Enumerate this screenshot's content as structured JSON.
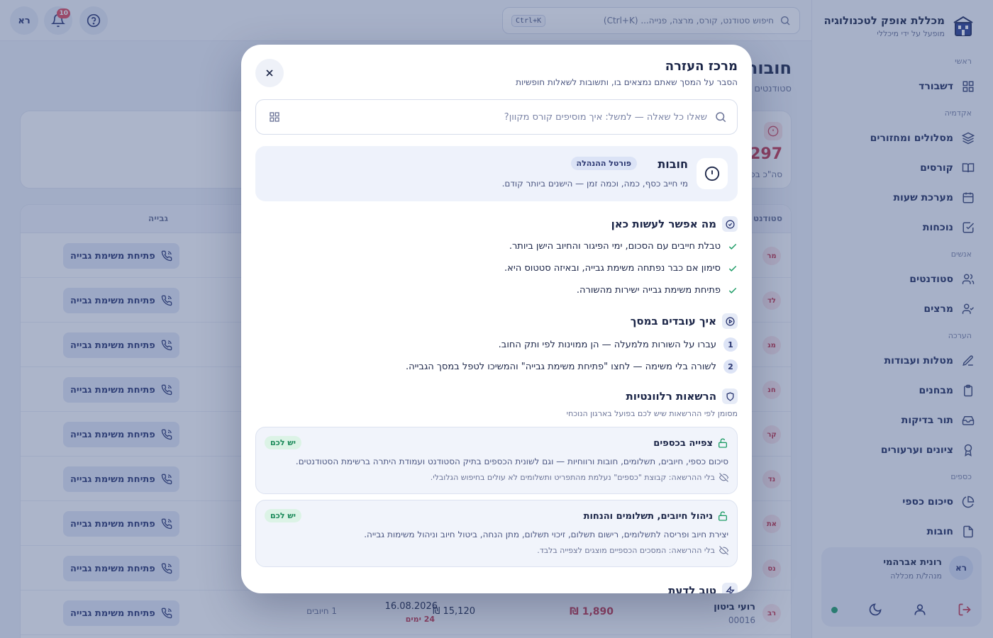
{
  "brand": {
    "title": "מכללת אופק לטכנולוגיה",
    "subtitle": "מופעל על ידי מיכללי"
  },
  "topbar": {
    "search_placeholder": "חיפוש סטודנט, קורס, מרצה, פנייה... (Ctrl+K)",
    "search_shortcut": "Ctrl+K",
    "notifications_count": "10",
    "user_initials": "רא"
  },
  "sidebar": {
    "sections": [
      {
        "label": "ראשי",
        "items": [
          {
            "label": "דשבורד",
            "icon": "dashboard-icon"
          }
        ]
      },
      {
        "label": "אקדמיה",
        "items": [
          {
            "label": "מסלולים ומחזורים",
            "icon": "layers-icon"
          },
          {
            "label": "קורסים",
            "icon": "book-icon"
          },
          {
            "label": "מערכת שעות",
            "icon": "calendar-icon"
          },
          {
            "label": "נוכחות",
            "icon": "check-square-icon"
          }
        ]
      },
      {
        "label": "אנשים",
        "items": [
          {
            "label": "סטודנטים",
            "icon": "users-icon"
          },
          {
            "label": "מרצים",
            "icon": "user-check-icon"
          }
        ]
      },
      {
        "label": "הערכה",
        "items": [
          {
            "label": "מטלות ועבודות",
            "icon": "pen-icon"
          },
          {
            "label": "מבחנים",
            "icon": "clipboard-icon"
          },
          {
            "label": "תור בדיקות",
            "icon": "inbox-icon"
          },
          {
            "label": "ציונים וערעורים",
            "icon": "award-icon"
          }
        ]
      },
      {
        "label": "כספים",
        "items": [
          {
            "label": "סיכום כספי",
            "icon": "pie-chart-icon"
          },
          {
            "label": "חובות",
            "icon": "file-icon"
          }
        ]
      }
    ],
    "user": {
      "initials": "רא",
      "name": "רונית אברהמי",
      "role": "מנהל/ת מכללה"
    }
  },
  "page": {
    "title": "חובות",
    "subtitle": "סטודנטים",
    "stat_value": ",297",
    "stat_label": "סה\"כ בפ",
    "table_headers": {
      "student": "סטודנט",
      "collection": "גבייה"
    },
    "collect_label": "פתיחת משימת גבייה",
    "rows": [
      {
        "initials": "מר",
        "name": "",
        "id": "",
        "debt": "",
        "total": "",
        "date": "",
        "days": "",
        "count": ""
      },
      {
        "initials": "לד",
        "name": "",
        "id": "",
        "debt": "",
        "total": "",
        "date": "",
        "days": "",
        "count": ""
      },
      {
        "initials": "מג",
        "name": "",
        "id": "",
        "debt": "",
        "total": "",
        "date": "",
        "days": "",
        "count": ""
      },
      {
        "initials": "חנ",
        "name": "",
        "id": "",
        "debt": "",
        "total": "",
        "date": "",
        "days": "",
        "count": ""
      },
      {
        "initials": "קר",
        "name": "",
        "id": "",
        "debt": "",
        "total": "",
        "date": "",
        "days": "",
        "count": ""
      },
      {
        "initials": "נד",
        "name": "",
        "id": "",
        "debt": "",
        "total": "",
        "date": "",
        "days": "",
        "count": ""
      },
      {
        "initials": "את",
        "name": "",
        "id": "",
        "debt": "",
        "total": "",
        "date": "",
        "days": "",
        "count": ""
      },
      {
        "initials": "נס",
        "name": "",
        "id": "",
        "debt": "",
        "total": "",
        "date": "",
        "days": "",
        "count": ""
      },
      {
        "initials": "רב",
        "name": "רועי ביטון",
        "id": "00016",
        "debt": "₪ 1,890",
        "total": "₪ 15,120",
        "date": "16.08.2026",
        "days": "24 ימים",
        "count": "1 חיובים"
      }
    ]
  },
  "help": {
    "title": "מרכז העזרה",
    "subtitle": "הסבר על המסך שאתם נמצאים בו, ותשובות לשאלות חופשיות",
    "search_placeholder": "שאלו כל שאלה — למשל: איך מוסיפים קורס מקוון?",
    "page": {
      "title": "חובות",
      "badge": "פורטל ההנהלה",
      "description": "מי חייב כסף, כמה, וכמה זמן — הישנים ביותר קודם."
    },
    "can_do": {
      "title": "מה אפשר לעשות כאן",
      "items": [
        "טבלת חייבים עם הסכום, ימי הפיגור והחיוב הישן ביותר.",
        "סימון אם כבר נפתחה משימת גבייה, ובאיזה סטטוס היא.",
        "פתיחת משימת גבייה ישירות מהשורה."
      ]
    },
    "how_to": {
      "title": "איך עובדים במסך",
      "steps": [
        {
          "num": "1",
          "text": "עברו על השורות מלמעלה — הן ממוינות לפי ותק החוב."
        },
        {
          "num": "2",
          "text": "לשורה בלי משימה — לחצו \"פתיחת משימת גבייה\" והמשיכו לטפל במסך הגבייה."
        }
      ]
    },
    "permissions": {
      "title": "הרשאות רלוונטיות",
      "note": "מסומן לפי ההרשאות שיש לכם בפועל בארגון הנוכחי",
      "cards": [
        {
          "title": "צפייה בכספים",
          "badge": "יש לכם",
          "description": "סיכום כספי, חיובים, תשלומים, חובות ורווחיות — וגם לשונית הכספים בתיק הסטודנט ועמודת היתרה ברשימת הסטודנטים.",
          "without": "בלי ההרשאה: קבוצת \"כספים\" נעלמת מהתפריט ותשלומים לא עולים בחיפוש הגלובלי."
        },
        {
          "title": "ניהול חיובים, תשלומים והנחות",
          "badge": "יש לכם",
          "description": "יצירת חיוב ופריסה לתשלומים, רישום תשלום, זיכוי תשלום, מתן הנחה, ביטול חיוב וניהול משימות גבייה.",
          "without": "בלי ההרשאה: המסכים הכספיים מוצגים לצפייה בלבד."
        }
      ]
    },
    "good_to_know": {
      "title": "טוב לדעת"
    }
  },
  "colors": {
    "accent": "#2a3670",
    "danger": "#c6364a",
    "success": "#1f9d67",
    "overlay": "#3a4e80"
  }
}
